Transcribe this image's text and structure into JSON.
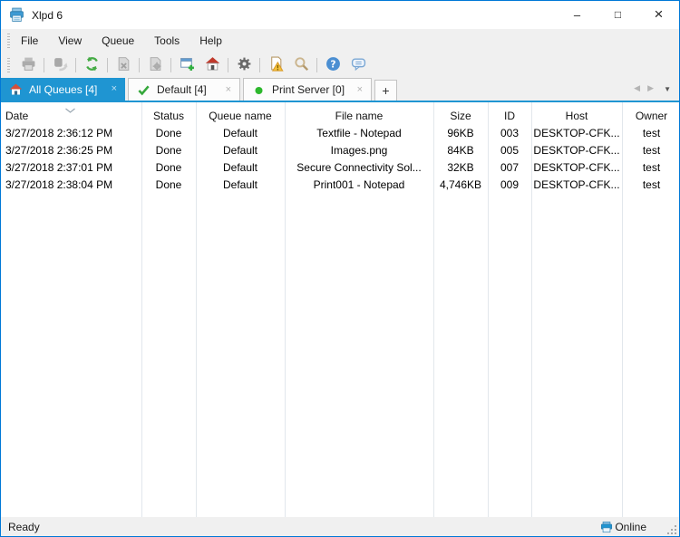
{
  "window": {
    "title": "Xlpd 6",
    "controls": {
      "minimize": "–",
      "maximize": "□",
      "close": "×"
    }
  },
  "menu": {
    "items": [
      {
        "label": "File"
      },
      {
        "label": "View"
      },
      {
        "label": "Queue"
      },
      {
        "label": "Tools"
      },
      {
        "label": "Help"
      }
    ]
  },
  "toolbar": {
    "buttons": [
      {
        "name": "print",
        "enabled": false
      },
      {
        "name": "resume",
        "enabled": false
      },
      {
        "name": "refresh",
        "enabled": true
      },
      {
        "name": "delete-job",
        "enabled": false
      },
      {
        "name": "job-properties",
        "enabled": false
      },
      {
        "name": "new-queue",
        "enabled": true
      },
      {
        "name": "home",
        "enabled": true
      },
      {
        "name": "settings",
        "enabled": true
      },
      {
        "name": "view-log",
        "enabled": true
      },
      {
        "name": "search",
        "enabled": false
      },
      {
        "name": "help",
        "enabled": true
      },
      {
        "name": "feedback",
        "enabled": true
      }
    ]
  },
  "tab_bar": {
    "tabs": [
      {
        "label": "All Queues [4]",
        "icon": "home-icon",
        "active": true
      },
      {
        "label": "Default [4]",
        "icon": "check-icon",
        "active": false
      },
      {
        "label": "Print Server [0]",
        "icon": "green-dot-icon",
        "active": false
      }
    ],
    "close_glyph": "×",
    "add_tab_glyph": "+",
    "nav_left_glyph": "◀",
    "nav_right_glyph": "▶",
    "dropdown_glyph": "▼"
  },
  "table": {
    "columns": [
      {
        "label": "Date",
        "sort": "chevron-down"
      },
      {
        "label": "Status"
      },
      {
        "label": "Queue name"
      },
      {
        "label": "File name"
      },
      {
        "label": "Size"
      },
      {
        "label": "ID"
      },
      {
        "label": "Host"
      },
      {
        "label": "Owner"
      }
    ],
    "rows": [
      {
        "date": "3/27/2018 2:36:12 PM",
        "status": "Done",
        "queue": "Default",
        "file": "Textfile - Notepad",
        "size": "96KB",
        "id": "003",
        "host": "DESKTOP-CFK...",
        "owner": "test"
      },
      {
        "date": "3/27/2018 2:36:25 PM",
        "status": "Done",
        "queue": "Default",
        "file": "Images.png",
        "size": "84KB",
        "id": "005",
        "host": "DESKTOP-CFK...",
        "owner": "test"
      },
      {
        "date": "3/27/2018 2:37:01 PM",
        "status": "Done",
        "queue": "Default",
        "file": "Secure Connectivity Sol...",
        "size": "32KB",
        "id": "007",
        "host": "DESKTOP-CFK...",
        "owner": "test"
      },
      {
        "date": "3/27/2018 2:38:04 PM",
        "status": "Done",
        "queue": "Default",
        "file": "Print001 - Notepad",
        "size": "4,746KB",
        "id": "009",
        "host": "DESKTOP-CFK...",
        "owner": "test"
      }
    ]
  },
  "status_bar": {
    "left": "Ready",
    "online": "Online"
  },
  "colors": {
    "accent_blue": "#1f95d2",
    "window_border": "#0078d7",
    "bar_bg": "#f0f0f0",
    "grid_line": "#e2e7ec",
    "refresh_green": "#44ab44",
    "check_green": "#35a83b",
    "dot_green": "#2db82d",
    "roof_red": "#c0392b",
    "warning_orange": "#f5c33b"
  }
}
